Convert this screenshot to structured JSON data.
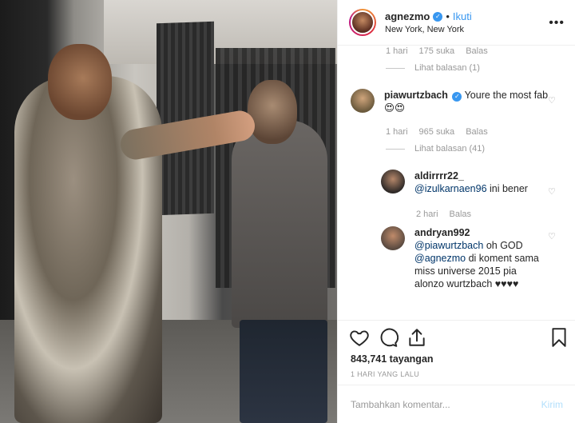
{
  "header": {
    "username": "agnezmo",
    "dot": "•",
    "follow_label": "Ikuti",
    "location": "New York, New York",
    "more_label": "•••"
  },
  "comments": {
    "top_meta": {
      "time": "1 hari",
      "likes": "175 suka",
      "reply": "Balas"
    },
    "top_view_replies": "Lihat balasan (1)",
    "items": [
      {
        "username": "piawurtzbach",
        "verified": true,
        "text": "Youre the most fab 😍😍",
        "time": "1 hari",
        "likes": "965 suka",
        "reply": "Balas",
        "view_replies": "Lihat balasan (41)"
      }
    ],
    "replies": [
      {
        "username": "aldirrrr22_",
        "mention": "@izulkarnaen96",
        "text": " ini bener",
        "time": "2 hari",
        "reply": "Balas"
      },
      {
        "username": "andryan992",
        "mention1": "@piawurtzbach",
        "text1": " oh GOD ",
        "mention2": "@agnezmo",
        "text2": " di koment sama miss universe 2015 pia alonzo wurtzbach ♥♥♥♥"
      }
    ]
  },
  "actions": {
    "views": "843,741 tayangan",
    "time": "1 HARI YANG LALU"
  },
  "add_comment": {
    "placeholder": "Tambahkan komentar...",
    "post_label": "Kirim"
  },
  "colors": {
    "accent": "#3897f0",
    "muted": "#999999",
    "mention": "#003569"
  }
}
